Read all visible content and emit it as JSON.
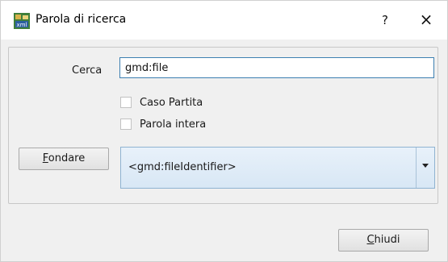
{
  "dialog": {
    "title": "Parola di ricerca",
    "help_glyph": "?",
    "close_glyph": "×",
    "icon": "xml-tree-icon"
  },
  "search": {
    "label": "Cerca",
    "value": "gmd:file"
  },
  "options": [
    {
      "label": "Caso Partita",
      "checked": false
    },
    {
      "label": "Parola intera",
      "checked": false
    }
  ],
  "find_button": {
    "mnemonic": "F",
    "rest": "ondare"
  },
  "results": {
    "selected": "<gmd:fileIdentifier>"
  },
  "close_button": {
    "mnemonic": "C",
    "rest": "hiudi"
  }
}
